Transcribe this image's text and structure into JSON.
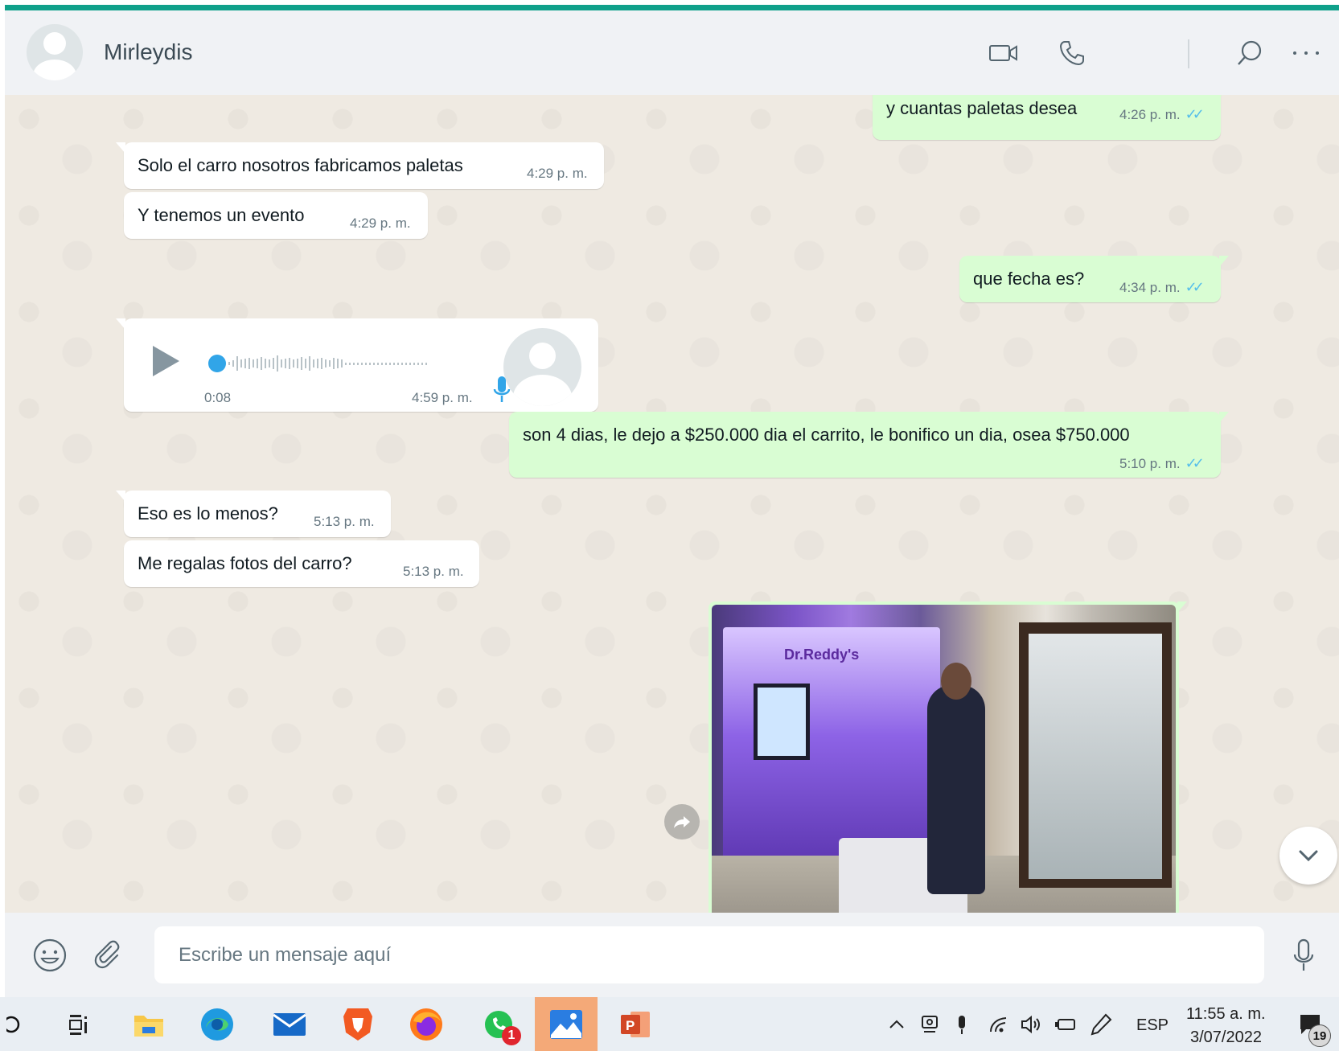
{
  "header": {
    "contact_name": "Mirleydis",
    "icons": [
      "video-call-icon",
      "voice-call-icon",
      "search-icon",
      "menu-icon"
    ]
  },
  "messages": [
    {
      "direction": "out",
      "text": "y cuantas paletas desea",
      "time": "4:26 p. m.",
      "status": "read"
    },
    {
      "direction": "in",
      "text": "Solo el carro nosotros fabricamos paletas",
      "time": "4:29 p. m."
    },
    {
      "direction": "in",
      "text": "Y tenemos un evento",
      "time": "4:29 p. m."
    },
    {
      "direction": "out",
      "text": "que fecha es?",
      "time": "4:34 p. m.",
      "status": "read"
    },
    {
      "direction": "in",
      "type": "voice",
      "duration": "0:08",
      "time": "4:59 p. m."
    },
    {
      "direction": "out",
      "text": "son 4 dias, le dejo a $250.000 dia el carrito, le bonifico un dia, osea $750.000",
      "time": "5:10 p. m.",
      "status": "read"
    },
    {
      "direction": "in",
      "text": "Eso es lo menos?",
      "time": "5:13 p. m."
    },
    {
      "direction": "in",
      "text": "Me regalas fotos del carro?",
      "time": "5:13 p. m."
    },
    {
      "direction": "out",
      "type": "image",
      "image_label": "Dr.Reddy's"
    }
  ],
  "composer": {
    "placeholder": "Escribe un mensaje aquí",
    "icons": [
      "emoji-icon",
      "attach-icon",
      "microphone-icon"
    ]
  },
  "taskbar": {
    "apps": [
      "search-circle-icon",
      "task-view-icon",
      "file-explorer-icon",
      "edge-icon",
      "mail-icon",
      "brave-icon",
      "firefox-icon",
      "whatsapp-icon",
      "photos-icon",
      "powerpoint-icon"
    ],
    "whatsapp_badge": "1",
    "language": "ESP",
    "time": "11:55 a. m.",
    "date": "3/07/2022",
    "notifications": "19"
  },
  "colors": {
    "accent": "#0fa08a",
    "outgoing_bubble": "#d9fdd3",
    "incoming_bubble": "#ffffff",
    "chat_background": "#efeae2",
    "read_tick": "#53bdeb"
  }
}
